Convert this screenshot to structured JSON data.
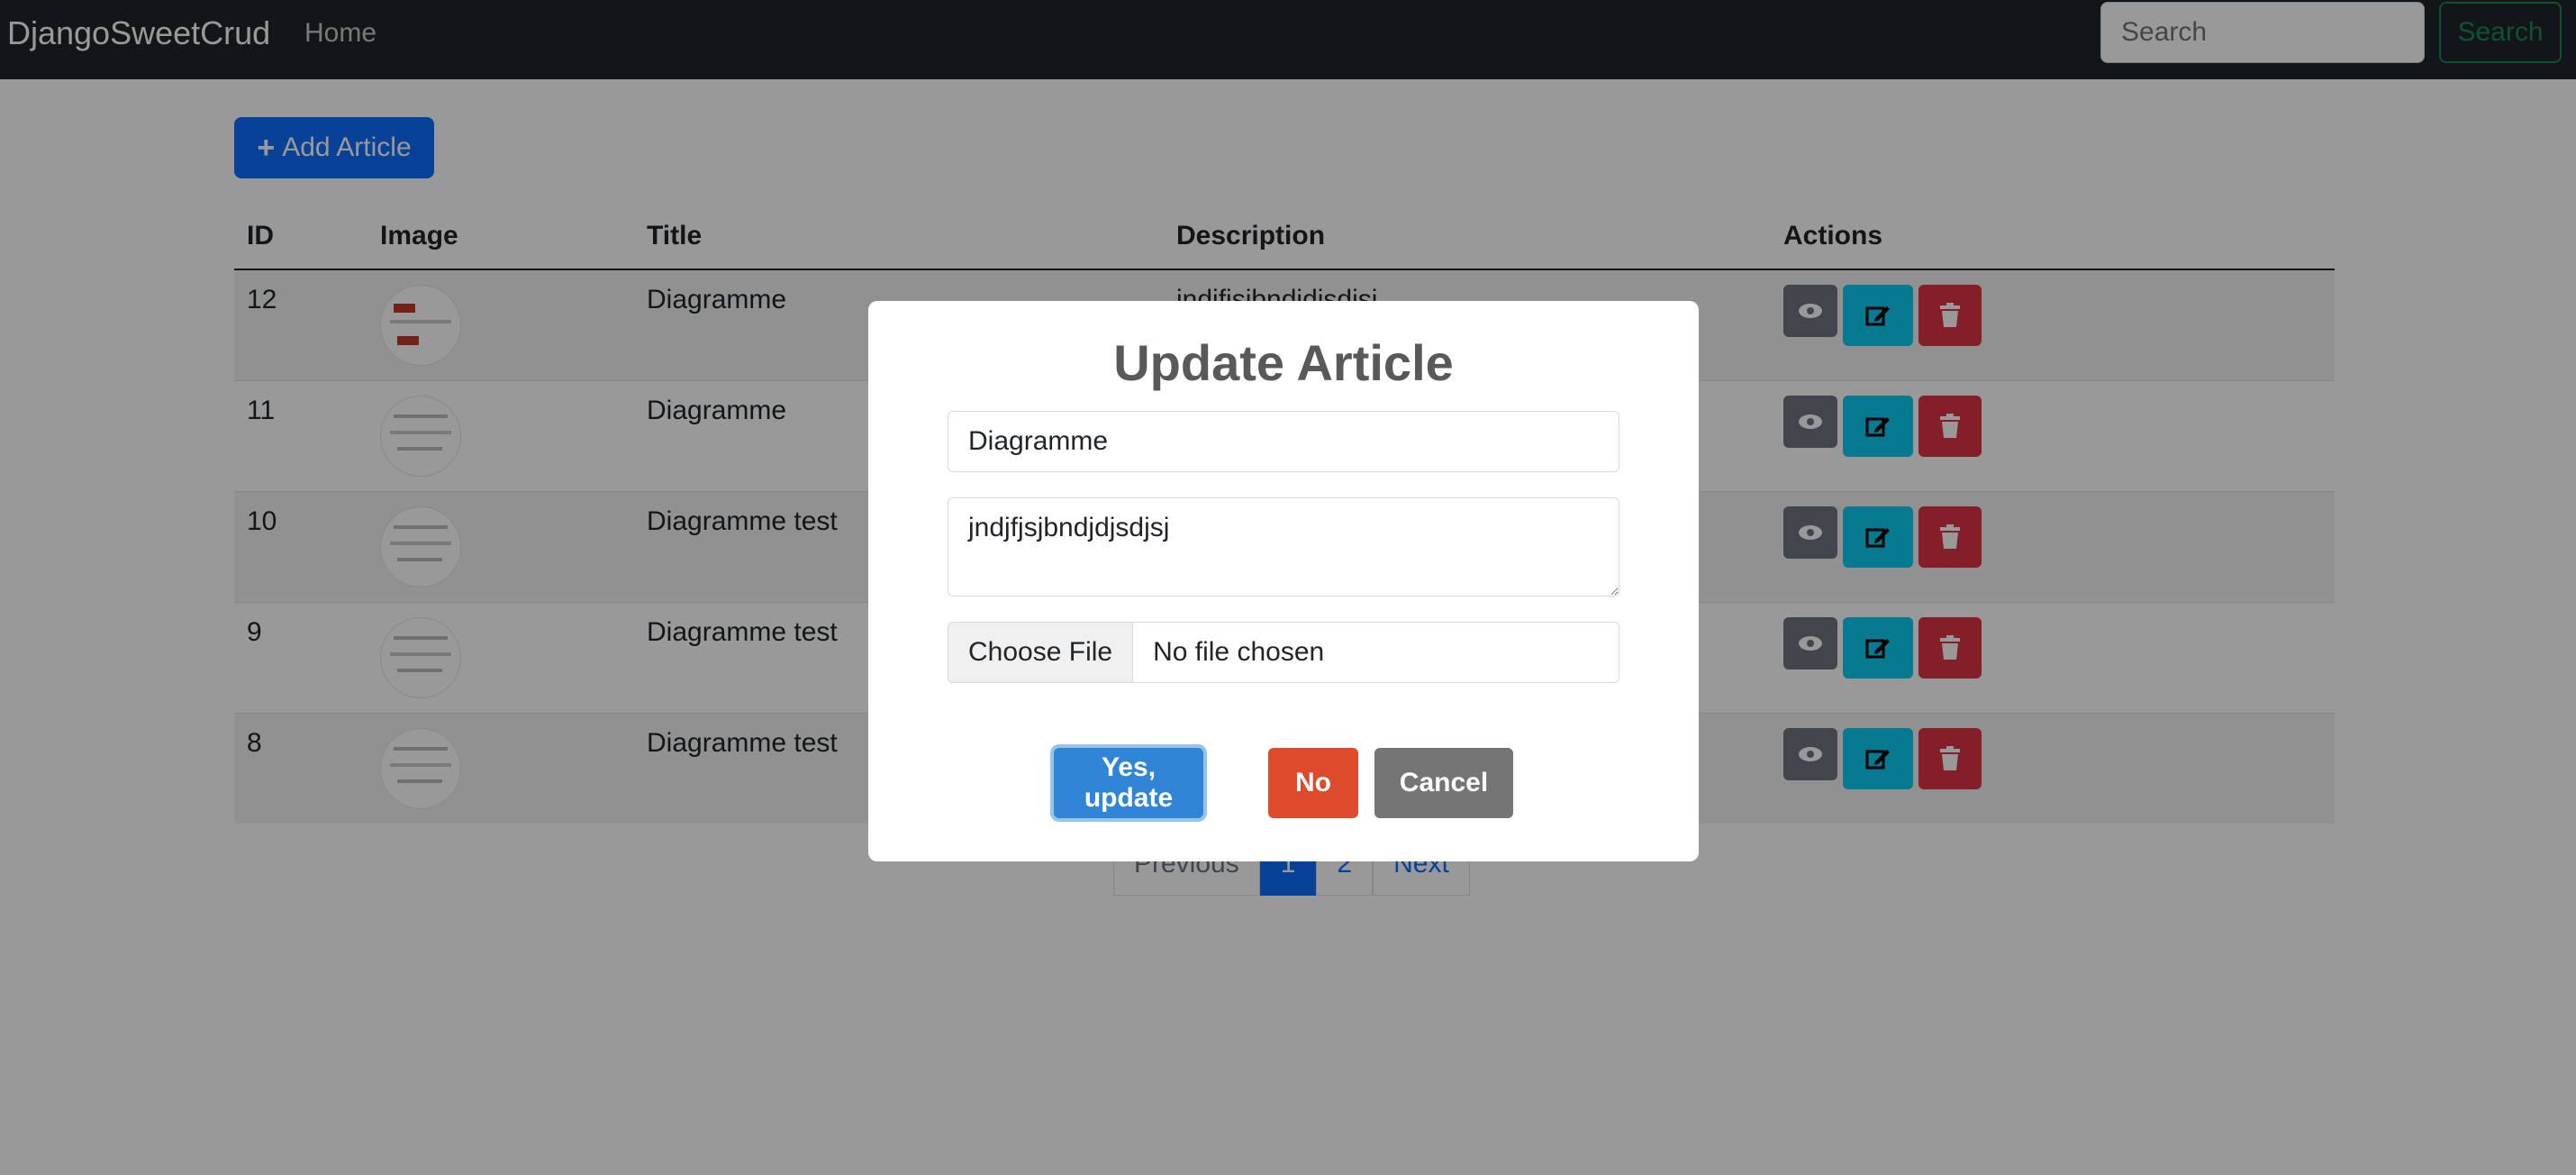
{
  "navbar": {
    "brand": "DjangoSweetCrud",
    "home": "Home",
    "search_placeholder": "Search",
    "search_button": "Search"
  },
  "toolbar": {
    "add_label": "Add Article"
  },
  "table": {
    "headers": [
      "ID",
      "Image",
      "Title",
      "Description",
      "Actions"
    ],
    "rows": [
      {
        "id": "12",
        "title": "Diagramme",
        "description": "jndjfjsjbndjdjsdjsj"
      },
      {
        "id": "11",
        "title": "Diagramme",
        "description": ""
      },
      {
        "id": "10",
        "title": "Diagramme test",
        "description": ""
      },
      {
        "id": "9",
        "title": "Diagramme test",
        "description": ""
      },
      {
        "id": "8",
        "title": "Diagramme test",
        "description": ""
      }
    ]
  },
  "pagination": {
    "previous": "Previous",
    "pages": [
      "1",
      "2"
    ],
    "next": "Next",
    "current": "1"
  },
  "modal": {
    "title": "Update Article",
    "title_value": "Diagramme",
    "description_value": "jndjfjsjbndjdjsdjsj",
    "file_button": "Choose File",
    "file_status": "No file chosen",
    "yes": "Yes, update",
    "no": "No",
    "cancel": "Cancel"
  },
  "colors": {
    "navbar": "#212529",
    "primary": "#0d6efd",
    "info": "#0dcaf0",
    "danger": "#dc3545",
    "secondary": "#6c757d",
    "confirm": "#3085d6",
    "deny": "#dd4b2c",
    "cancel": "#757575"
  }
}
